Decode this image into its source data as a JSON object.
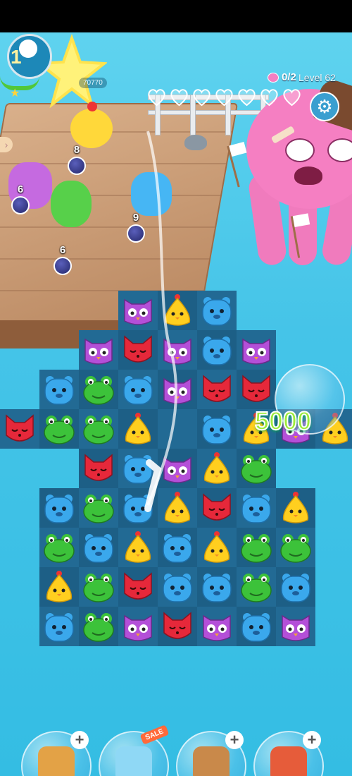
{
  "hud": {
    "level_number": "1",
    "score_text": "70770",
    "goal_text": "0/2",
    "level_text": "Level 62",
    "moves_hearts": 7,
    "settings_icon": "gear-icon"
  },
  "characters": [
    {
      "name": "owl-purple",
      "count": "6"
    },
    {
      "name": "chick-yellow",
      "count": "8"
    },
    {
      "name": "frog-green",
      "count": "6"
    },
    {
      "name": "bear-blue",
      "count": "9"
    }
  ],
  "combo_text": "5000",
  "board": {
    "rows": [
      [
        null,
        null,
        null,
        "owl",
        "chick",
        "bear",
        null,
        null,
        null
      ],
      [
        null,
        null,
        "owl",
        "fox",
        "owl",
        "bear",
        "owl",
        null,
        null
      ],
      [
        null,
        "bear",
        "frog",
        "bear",
        "owl",
        "fox",
        "fox",
        null,
        null
      ],
      [
        "fox",
        "frog",
        "frog",
        "chick",
        "empty",
        "bear",
        "chick",
        "owl",
        "chick"
      ],
      [
        null,
        null,
        "fox",
        "bear",
        "owl",
        "chick",
        "frog",
        null,
        null
      ],
      [
        null,
        "bear",
        "frog",
        "bear",
        "chick",
        "fox",
        "bear",
        "chick",
        null
      ],
      [
        null,
        "frog",
        "bear",
        "chick",
        "bear",
        "chick",
        "frog",
        "frog",
        null
      ],
      [
        null,
        "chick",
        "frog",
        "fox",
        "bear",
        "bear",
        "frog",
        "bear",
        null
      ],
      [
        null,
        "bear",
        "frog",
        "owl",
        "fox",
        "owl",
        "bear",
        "owl",
        null
      ]
    ]
  },
  "boosters": [
    {
      "name": "hammer-booster",
      "icon": "hammer-icon",
      "has_plus": true
    },
    {
      "name": "shuffle-booster",
      "icon": "swirl-icon",
      "badge": "SALE"
    },
    {
      "name": "bear-booster",
      "icon": "bear-icon",
      "has_plus": true
    },
    {
      "name": "swap-booster",
      "icon": "swap-icon",
      "has_plus": true
    }
  ],
  "help_label": "?",
  "colors": {
    "owl": "#b44fd8",
    "fox": "#e6283a",
    "bear": "#3aa8ec",
    "frog": "#3cc23a",
    "chick": "#ffcf1f"
  }
}
